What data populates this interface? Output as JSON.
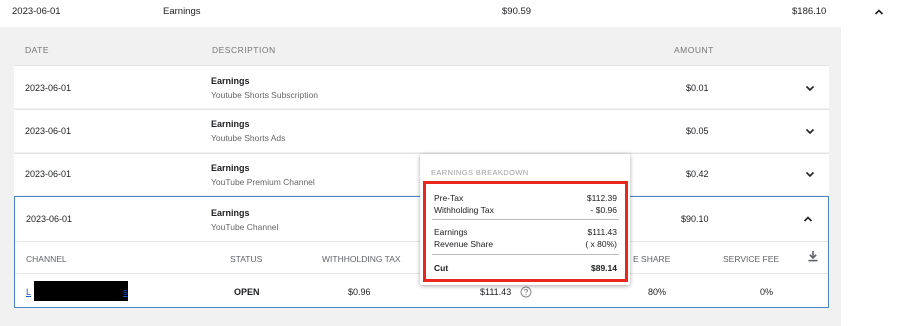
{
  "top_row": {
    "date": "2023-06-01",
    "description": "Earnings",
    "amount1": "$90.59",
    "amount2": "$186.10"
  },
  "table_header": {
    "date": "DATE",
    "description": "DESCRIPTION",
    "amount": "AMOUNT"
  },
  "rows": [
    {
      "date": "2023-06-01",
      "title": "Earnings",
      "subtitle": "Youtube Shorts Subscription",
      "amount": "$0.01"
    },
    {
      "date": "2023-06-01",
      "title": "Earnings",
      "subtitle": "Youtube Shorts Ads",
      "amount": "$0.05"
    },
    {
      "date": "2023-06-01",
      "title": "Earnings",
      "subtitle": "YouTube Premium Channel",
      "amount": "$0.42"
    },
    {
      "date": "2023-06-01",
      "title": "Earnings",
      "subtitle": "YouTube Channel",
      "amount": "$90.10"
    }
  ],
  "sub_table": {
    "headers": {
      "channel": "CHANNEL",
      "status": "STATUS",
      "withholding_tax": "WITHHOLDING TAX",
      "revenue_share": "E SHARE",
      "service_fee": "SERVICE FEE"
    },
    "row": {
      "channel_start": "L",
      "channel_end": "s",
      "status": "OPEN",
      "withholding_tax": "$0.96",
      "earnings": "$111.43",
      "revenue_share": "80%",
      "service_fee": "0%"
    }
  },
  "popup": {
    "title": "EARNINGS BREAKDOWN",
    "pre_tax_label": "Pre-Tax",
    "pre_tax_value": "$112.39",
    "withholding_label": "Withholding Tax",
    "withholding_value": "- $0.96",
    "earnings_label": "Earnings",
    "earnings_value": "$111.43",
    "revenue_share_label": "Revenue Share",
    "revenue_share_value": "( x 80%)",
    "cut_label": "Cut",
    "cut_value": "$89.14"
  },
  "colors": {
    "panel_bg": "#f1f1f1",
    "highlight_border": "#e8281e",
    "expanded_border": "#4a86c8",
    "link": "#1a56c8"
  },
  "icons": [
    "chevron-up-icon",
    "chevron-down-icon",
    "download-icon",
    "help-circle-icon"
  ]
}
